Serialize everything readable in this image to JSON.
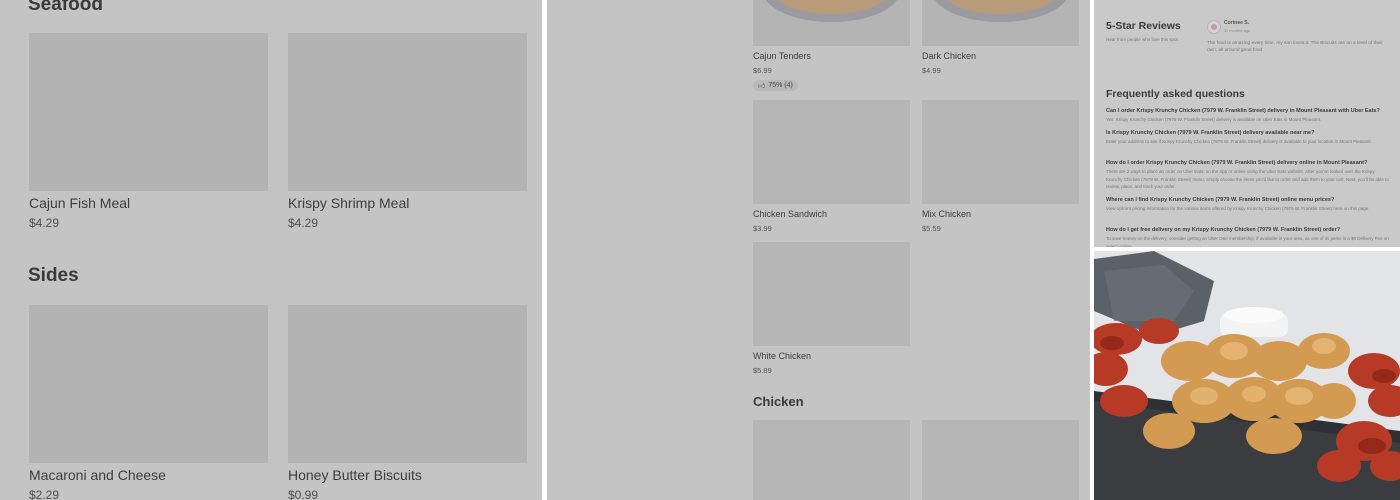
{
  "panel1": {
    "sections": [
      {
        "title": "Seafood",
        "items": [
          {
            "name": "Cajun Fish Meal",
            "price": "$4.29"
          },
          {
            "name": "Krispy Shrimp Meal",
            "price": "$4.29"
          }
        ]
      },
      {
        "title": "Sides",
        "items": [
          {
            "name": "Macaroni and Cheese",
            "price": "$2.29"
          },
          {
            "name": "Honey Butter Biscuits",
            "price": "$0.99"
          }
        ]
      }
    ]
  },
  "panel2": {
    "items": [
      {
        "name": "Cajun Tenders",
        "price": "$6.99",
        "rating": "75% (4)"
      },
      {
        "name": "Dark Chicken",
        "price": "$4.99"
      },
      {
        "name": "Chicken Sandwich",
        "price": "$3.99"
      },
      {
        "name": "Mix Chicken",
        "price": "$5.59"
      },
      {
        "name": "White Chicken",
        "price": "$5.89"
      }
    ],
    "section_title": "Chicken"
  },
  "panel3": {
    "reviews_title": "5-Star Reviews",
    "reviews_subtitle": "Hear from people who love this spot",
    "review": {
      "author": "Cortnee S.",
      "date": "11 months ago",
      "text": "The food is amazing every time, my son loves it. The Biscuits are on a level of their own, all around good food"
    },
    "faq_title": "Frequently asked questions",
    "faqs": [
      {
        "q": "Can I order Krispy Krunchy Chicken (7979 W. Franklin Street) delivery in Mount Pleasant with Uber Eats?",
        "a": "Yes. Krispy Krunchy Chicken (7979 W. Franklin Street) delivery is available on Uber Eats in Mount Pleasant."
      },
      {
        "q": "Is Krispy Krunchy Chicken (7979 W. Franklin Street) delivery available near me?",
        "a": "Enter your address to see if Krispy Krunchy Chicken (7979 W. Franklin Street) delivery is available to your location in Mount Pleasant."
      },
      {
        "q": "How do I order Krispy Krunchy Chicken (7979 W. Franklin Street) delivery online in Mount Pleasant?",
        "a": "There are 2 ways to place an order on Uber Eats: on the app or online using the Uber Eats website. After you've looked over the Krispy Krunchy Chicken (7979 W. Franklin Street) menu, simply choose the items you'd like to order and add them to your cart. Next, you'll be able to review, place, and track your order."
      },
      {
        "q": "Where can I find Krispy Krunchy Chicken (7979 W. Franklin Street) online menu prices?",
        "a": "View upfront pricing information for the various items offered by Krispy Krunchy Chicken (7979 W. Franklin Street) here on this page."
      },
      {
        "q": "How do I get free delivery on my Krispy Krunchy Chicken (7979 W. Franklin Street) order?",
        "a": "To save money on the delivery, consider getting an Uber One membership, if available in your area, as one of its perks is a $0 Delivery Fee on select orders."
      }
    ]
  },
  "colors": {
    "overlay": "#c4c4c4",
    "placeholder": "#b3b3b3",
    "wing_sauce": "#c0392b",
    "fried": "#d9a55e"
  },
  "icons": {
    "rating": "thumbs-up-icon"
  }
}
